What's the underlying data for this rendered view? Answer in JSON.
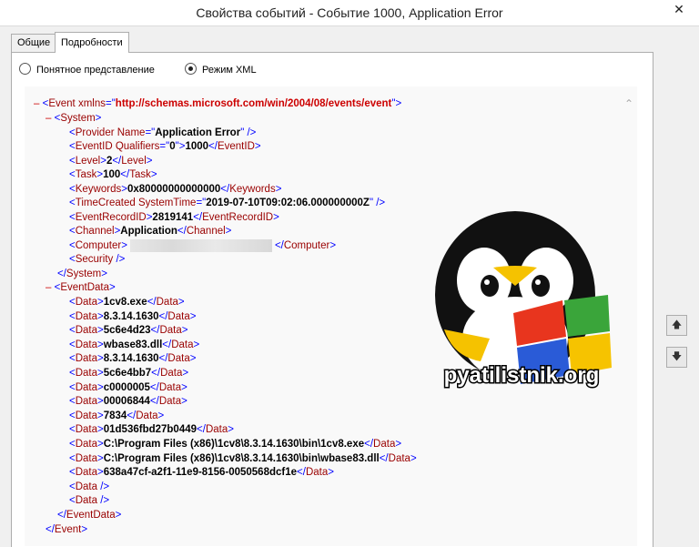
{
  "window": {
    "title": "Свойства событий - Событие 1000, Application Error",
    "close_glyph": "✕"
  },
  "tabs": [
    {
      "label": "Общие"
    },
    {
      "label": "Подробности"
    }
  ],
  "view_options": {
    "friendly": {
      "label": "Понятное представление",
      "checked": false
    },
    "xml": {
      "label": "Режим XML",
      "checked": true
    }
  },
  "xml": {
    "toggle": "–",
    "event": {
      "tag": "Event",
      "attr_name": "xmlns",
      "attr_value": "http://schemas.microsoft.com/win/2004/08/events/event"
    },
    "system_tag": "System",
    "provider": {
      "tag": "Provider",
      "attr": "Name",
      "value": "Application Error"
    },
    "eventid": {
      "tag": "EventID",
      "attr": "Qualifiers",
      "attr_value": "0",
      "text": "1000"
    },
    "level": {
      "tag": "Level",
      "text": "2"
    },
    "task": {
      "tag": "Task",
      "text": "100"
    },
    "keywords": {
      "tag": "Keywords",
      "text": "0x80000000000000"
    },
    "timecreated": {
      "tag": "TimeCreated",
      "attr": "SystemTime",
      "value": "2019-07-10T09:02:06.000000000Z"
    },
    "eventrecordid": {
      "tag": "EventRecordID",
      "text": "2819141"
    },
    "channel": {
      "tag": "Channel",
      "text": "Application"
    },
    "computer": {
      "tag": "Computer"
    },
    "security": {
      "tag": "Security"
    },
    "eventdata_tag": "EventData",
    "data_tag": "Data",
    "data_values": [
      "1cv8.exe",
      "8.3.14.1630",
      "5c6e4d23",
      "wbase83.dll",
      "8.3.14.1630",
      "5c6e4bb7",
      "c0000005",
      "00006844",
      "7834",
      "01d536fbd27b0449",
      "C:\\Program Files (x86)\\1cv8\\8.3.14.1630\\bin\\1cv8.exe",
      "C:\\Program Files (x86)\\1cv8\\8.3.14.1630\\bin\\wbase83.dll",
      "638a47cf-a2f1-11e9-8156-0050568dcf1e"
    ],
    "empty_data_count": 2
  },
  "watermark": {
    "text": "pyatilistnik.org"
  },
  "side_buttons": {
    "up_glyph": "🡅",
    "down_glyph": "🡇"
  }
}
